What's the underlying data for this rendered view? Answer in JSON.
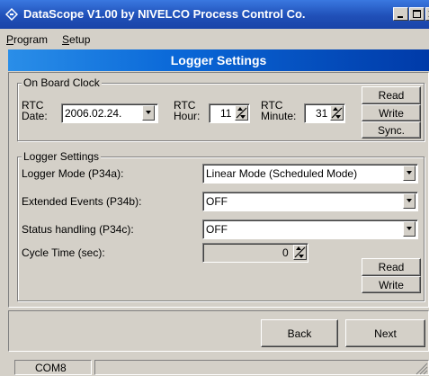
{
  "window": {
    "title": "DataScope V1.00 by NIVELCO Process Control Co.",
    "controls": {
      "minimize": "minimize",
      "maximize": "maximize",
      "close": "close"
    }
  },
  "menu": {
    "program": "Program",
    "program_ul": "P",
    "program_rest": "rogram",
    "setup_ul": "S",
    "setup_rest": "etup"
  },
  "header": {
    "title": "Logger Settings"
  },
  "clock": {
    "legend": "On Board Clock",
    "date_label_1": "RTC",
    "date_label_2": "Date:",
    "date_value": "2006.02.24.",
    "hour_label_1": "RTC",
    "hour_label_2": "Hour:",
    "hour_value": "11",
    "minute_label_1": "RTC",
    "minute_label_2": "Minute:",
    "minute_value": "31",
    "read": "Read",
    "write": "Write",
    "sync": "Sync."
  },
  "logger": {
    "legend": "Logger Settings",
    "mode_label": "Logger Mode (P34a):",
    "mode_value": "Linear Mode (Scheduled Mode)",
    "events_label": "Extended  Events (P34b):",
    "events_value": "OFF",
    "status_label": "Status handling (P34c):",
    "status_value": "OFF",
    "cycle_label": "Cycle Time (sec):",
    "cycle_value": "0",
    "read": "Read",
    "write": "Write"
  },
  "nav": {
    "back": "Back",
    "next": "Next"
  },
  "status": {
    "port": "COM8"
  },
  "colors": {
    "titlebar": "#2050b8",
    "header": "#0a68d8",
    "face": "#d4d0c8"
  }
}
